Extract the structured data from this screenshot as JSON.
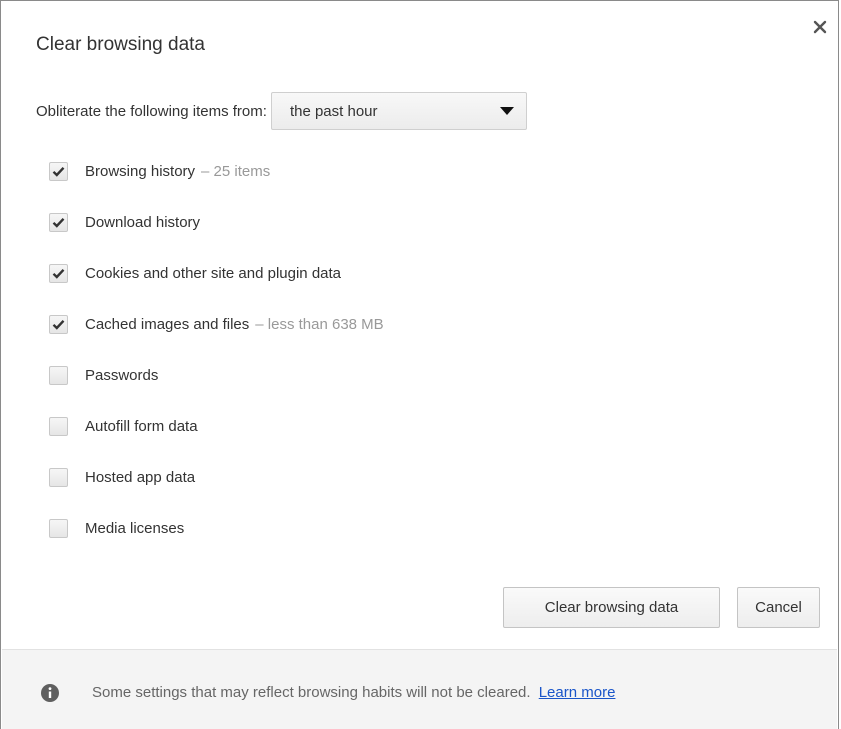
{
  "dialog": {
    "title": "Clear browsing data",
    "close_icon": "close-icon"
  },
  "range": {
    "label": "Obliterate the following items from:",
    "selected": "the past hour"
  },
  "options": [
    {
      "label": "Browsing history",
      "note": "– 25 items",
      "checked": true
    },
    {
      "label": "Download history",
      "note": "",
      "checked": true
    },
    {
      "label": "Cookies and other site and plugin data",
      "note": "",
      "checked": true
    },
    {
      "label": "Cached images and files",
      "note": "– less than 638 MB",
      "checked": true
    },
    {
      "label": "Passwords",
      "note": "",
      "checked": false
    },
    {
      "label": "Autofill form data",
      "note": "",
      "checked": false
    },
    {
      "label": "Hosted app data",
      "note": "",
      "checked": false
    },
    {
      "label": "Media licenses",
      "note": "",
      "checked": false
    }
  ],
  "buttons": {
    "clear_label": "Clear browsing data",
    "cancel_label": "Cancel"
  },
  "footer": {
    "icon": "info-icon",
    "text": "Some settings that may reflect browsing habits will not be cleared.",
    "link": "Learn more"
  },
  "colors": {
    "link": "#1a55c9",
    "note": "#999999",
    "footer_bg": "#f4f4f4"
  }
}
